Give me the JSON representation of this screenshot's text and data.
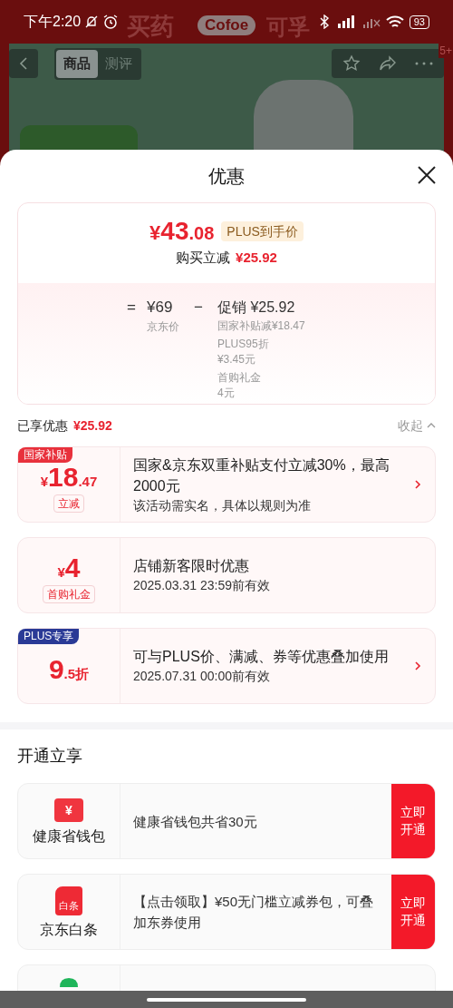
{
  "status_bar": {
    "time": "下午2:20",
    "battery": "93"
  },
  "background": {
    "brand": "买药",
    "sponsor_logo": "Cofoe",
    "sponsor_name": "可孚",
    "tabs": [
      {
        "label": "商品",
        "selected": true
      },
      {
        "label": "测评",
        "selected": false
      }
    ],
    "badge": "5+"
  },
  "sheet": {
    "title": "优惠",
    "summary": {
      "currency": "¥",
      "price_int": "43",
      "price_dec": ".08",
      "tag": "PLUS到手价",
      "reduction_label": "购买立减",
      "reduction": "¥25.92",
      "equals": "=",
      "base_price": "¥69",
      "base_label": "京东价",
      "minus": "−",
      "promo": "促销 ¥25.92",
      "promo_items": [
        {
          "lines": [
            "国家补贴减¥18.47"
          ]
        },
        {
          "lines": [
            "PLUS95折",
            "¥3.45元"
          ]
        },
        {
          "lines": [
            "首购礼金",
            "4元"
          ]
        }
      ]
    },
    "enjoyed": {
      "label": "已享优惠",
      "amount": "¥25.92",
      "collapse": "收起"
    },
    "offers": [
      {
        "tag": "国家补贴",
        "color": "#e8313c",
        "currency": "¥",
        "int": "18",
        "dec": ".47",
        "sub": "立减",
        "title": "国家&京东双重补贴支付立减30%，最高2000元",
        "note": "该活动需实名，具体以规则为准",
        "arrow": true
      },
      {
        "currency": "¥",
        "int": "4",
        "sub": "首购礼金",
        "title": "店铺新客限时优惠",
        "note": "2025.03.31 23:59前有效",
        "arrow": false
      },
      {
        "tag": "PLUS专享",
        "color": "#2a3a96",
        "int": "9",
        "dec": ".5折",
        "title": "可与PLUS价、满减、券等优惠叠加使用",
        "note": "2025.07.31 00:00前有效",
        "arrow": true
      }
    ],
    "open": {
      "title": "开通立享",
      "items": [
        {
          "kind": "wallet",
          "icon_text": "¥",
          "name": "健康省钱包",
          "desc": "健康省钱包共省30元",
          "button": "立即开通"
        },
        {
          "kind": "baitiao",
          "icon_text": "白条",
          "name": "京东白条",
          "desc": "【点击领取】¥50无门槛立减券包，可叠加东券使用",
          "button": "立即开通"
        },
        {
          "kind": "green"
        }
      ]
    }
  }
}
